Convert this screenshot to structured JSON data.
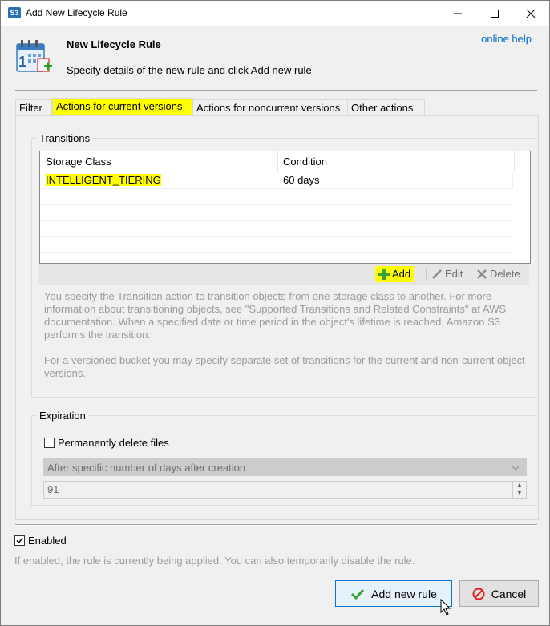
{
  "window": {
    "title": "Add New Lifecycle Rule",
    "app_icon_text": "S3"
  },
  "header": {
    "title": "New Lifecycle Rule",
    "subtitle": "Specify details of the new rule and click Add new rule",
    "online_help": "online help"
  },
  "tabs": [
    {
      "label": "Filter",
      "active": false
    },
    {
      "label": "Actions for current versions",
      "active": true
    },
    {
      "label": "Actions for noncurrent versions",
      "active": false
    },
    {
      "label": "Other actions",
      "active": false
    }
  ],
  "transitions": {
    "group_title": "Transitions",
    "columns": [
      "Storage Class",
      "Condition"
    ],
    "rows": [
      {
        "storage_class": "INTELLIGENT_TIERING",
        "condition": "60 days"
      }
    ],
    "toolbar": {
      "add": "Add",
      "edit": "Edit",
      "delete": "Delete"
    },
    "help_paragraph_1": "You specify the Transition action to transition objects from one storage class to another. For more information about transitioning objects, see \"Supported Transitions and Related Constraints\" at AWS documentation. When a specified date or time period in the object's lifetime is reached, Amazon S3 performs the transition.",
    "help_paragraph_2": "For a versioned bucket you may specify separate set of transitions for the current and non-current object versions."
  },
  "expiration": {
    "group_title": "Expiration",
    "permanently_delete_label": "Permanently delete files",
    "permanently_delete_checked": false,
    "mode_selected": "After specific number of days after creation",
    "days_value": "91"
  },
  "enabled": {
    "label": "Enabled",
    "checked": true,
    "help": "If enabled, the rule is currently being applied. You can also temporarily disable the rule."
  },
  "buttons": {
    "add_new_rule": "Add new rule",
    "cancel": "Cancel"
  },
  "colors": {
    "highlight": "#ffff00",
    "link": "#0066cc",
    "accent": "#0078d7"
  }
}
